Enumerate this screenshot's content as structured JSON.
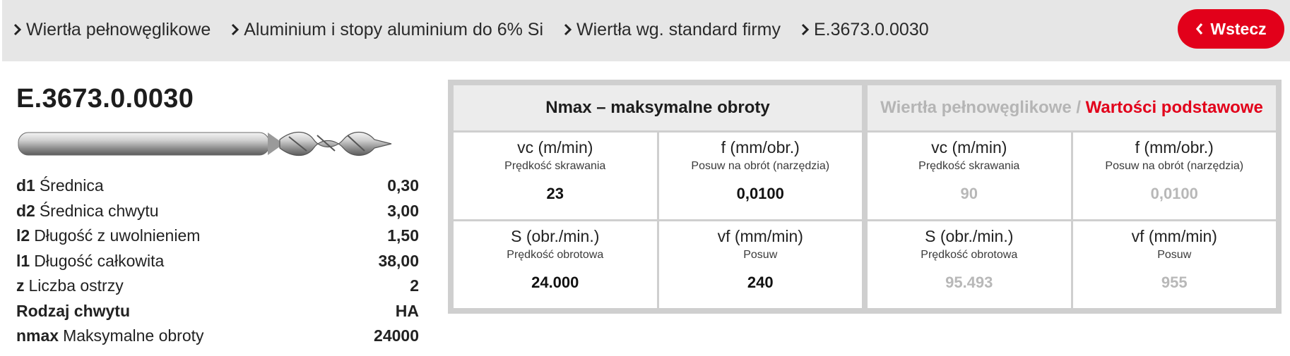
{
  "breadcrumbs": [
    "Wiertła pełnowęglikowe",
    "Aluminium i stopy aluminium do 6% Si",
    "Wiertła wg. standard firmy",
    "E.3673.0.0030"
  ],
  "back_button": "Wstecz",
  "colors": {
    "accent": "#e2001a",
    "muted": "#b5b5b5",
    "panel_bg": "#cfcfcf"
  },
  "product": {
    "code": "E.3673.0.0030",
    "specs": [
      {
        "key": "d1",
        "label": "Średnica",
        "value": "0,30"
      },
      {
        "key": "d2",
        "label": "Średnica chwytu",
        "value": "3,00"
      },
      {
        "key": "l2",
        "label": "Długość z uwolnieniem",
        "value": "1,50"
      },
      {
        "key": "l1",
        "label": "Długość całkowita",
        "value": "38,00"
      },
      {
        "key": "z",
        "label": "Liczba ostrzy",
        "value": "2"
      },
      {
        "key": "Rodzaj chwytu",
        "label": "",
        "value": "HA"
      },
      {
        "key": "nmax",
        "label": "Maksymalne obroty",
        "value": "24000"
      }
    ]
  },
  "nmax_block": {
    "title": "Nmax – maksymalne obroty",
    "cells": [
      {
        "unit": "vc (m/min)",
        "desc": "Prędkość skrawania",
        "value": "23"
      },
      {
        "unit": "f (mm/obr.)",
        "desc": "Posuw na obrót (narzędzia)",
        "value": "0,0100"
      },
      {
        "unit": "S (obr./min.)",
        "desc": "Prędkość obrotowa",
        "value": "24.000"
      },
      {
        "unit": "vf (mm/min)",
        "desc": "Posuw",
        "value": "240"
      }
    ]
  },
  "base_block": {
    "title_muted": "Wiertła pełnowęglikowe / ",
    "title_accent": "Wartości podstawowe",
    "cells": [
      {
        "unit": "vc (m/min)",
        "desc": "Prędkość skrawania",
        "value": "90"
      },
      {
        "unit": "f (mm/obr.)",
        "desc": "Posuw na obrót (narzędzia)",
        "value": "0,0100"
      },
      {
        "unit": "S (obr./min.)",
        "desc": "Prędkość obrotowa",
        "value": "95.493"
      },
      {
        "unit": "vf (mm/min)",
        "desc": "Posuw",
        "value": "955"
      }
    ]
  }
}
